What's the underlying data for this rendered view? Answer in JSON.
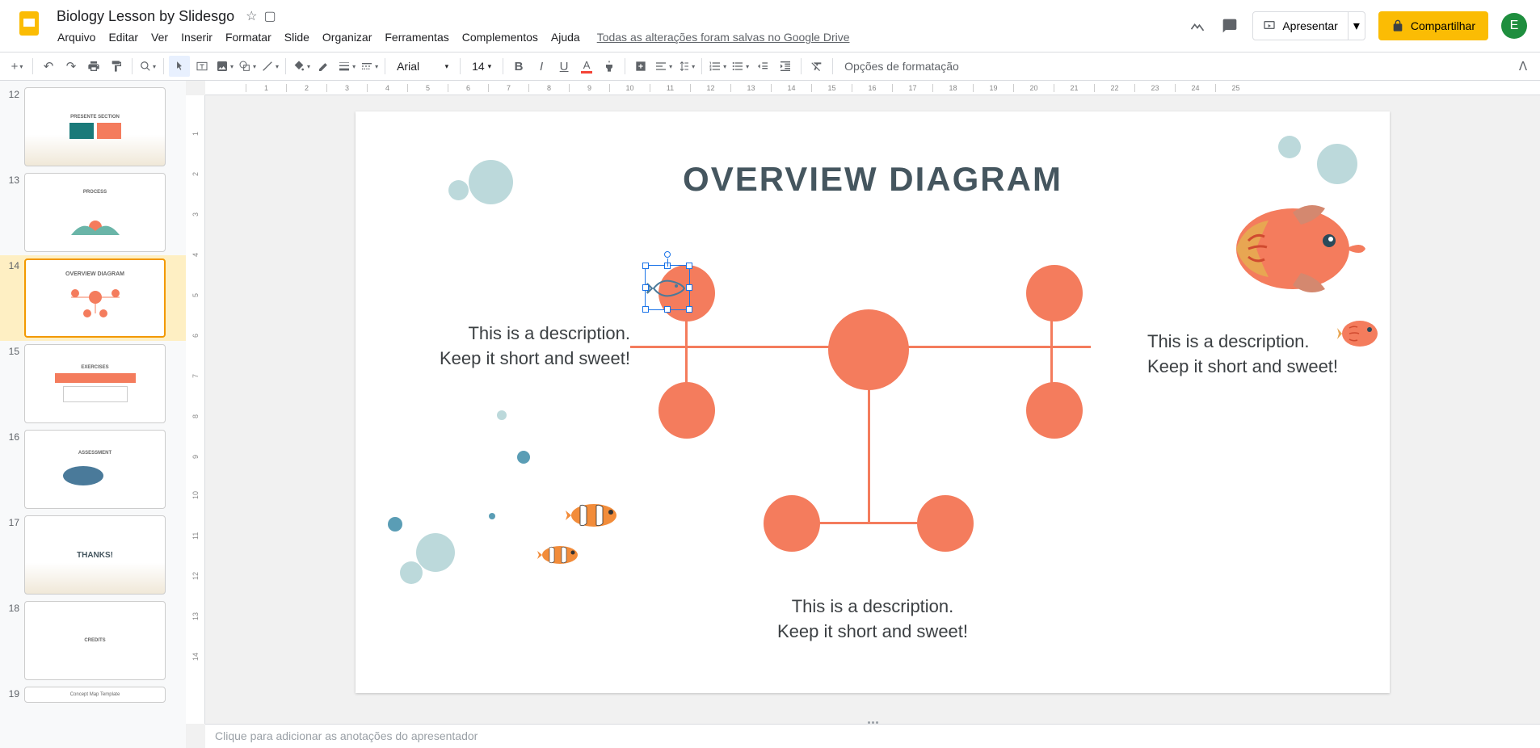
{
  "header": {
    "title": "Biology Lesson by Slidesgo",
    "menus": [
      "Arquivo",
      "Editar",
      "Ver",
      "Inserir",
      "Formatar",
      "Slide",
      "Organizar",
      "Ferramentas",
      "Complementos",
      "Ajuda"
    ],
    "save_status": "Todas as alterações foram salvas no Google Drive",
    "present_label": "Apresentar",
    "share_label": "Compartilhar",
    "avatar_letter": "E"
  },
  "toolbar": {
    "font": "Arial",
    "size": "14",
    "format_options": "Opções de formatação"
  },
  "filmstrip": {
    "slides": [
      {
        "number": "12",
        "title": "PRESENTE SECTION"
      },
      {
        "number": "13",
        "title": "PROCESS"
      },
      {
        "number": "14",
        "title": "OVERVIEW DIAGRAM",
        "active": true
      },
      {
        "number": "15",
        "title": "EXERCISES"
      },
      {
        "number": "16",
        "title": "ASSESSMENT"
      },
      {
        "number": "17",
        "title": "THANKS!"
      },
      {
        "number": "18",
        "title": "CREDITS"
      },
      {
        "number": "19",
        "title": "Concept Map Template"
      }
    ]
  },
  "slide": {
    "title": "OVERVIEW DIAGRAM",
    "desc1": "This is a description. Keep it short and sweet!",
    "desc2": "This is a description. Keep it short and sweet!",
    "desc3": "This is a description. Keep it short and sweet!"
  },
  "notes": {
    "placeholder": "Clique para adicionar as anotações do apresentador"
  },
  "ruler_h": [
    "1",
    "2",
    "3",
    "4",
    "5",
    "6",
    "7",
    "8",
    "9",
    "10",
    "11",
    "12",
    "13",
    "14",
    "15",
    "16",
    "17",
    "18",
    "19",
    "20",
    "21",
    "22",
    "23",
    "24",
    "25"
  ],
  "ruler_v": [
    "1",
    "2",
    "3",
    "4",
    "5",
    "6",
    "7",
    "8",
    "9",
    "10",
    "11",
    "12",
    "13",
    "14"
  ]
}
